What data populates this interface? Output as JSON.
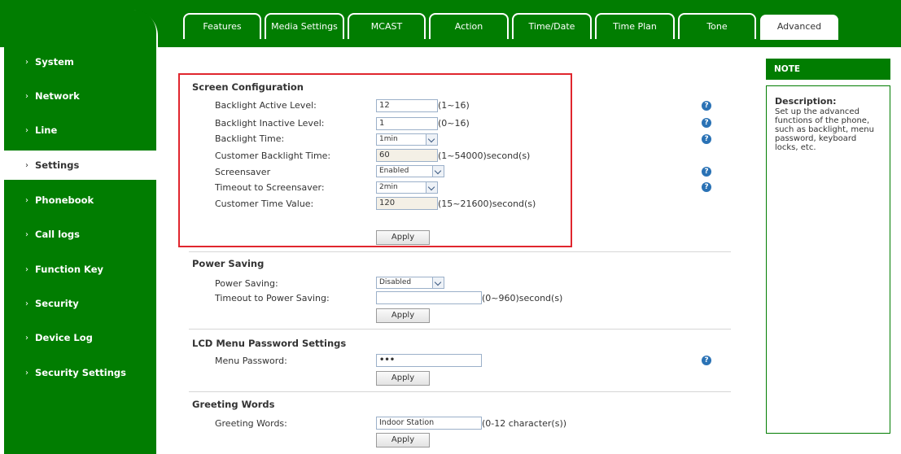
{
  "sidebar": {
    "items": [
      {
        "label": "System"
      },
      {
        "label": "Network"
      },
      {
        "label": "Line"
      },
      {
        "label": "Settings"
      },
      {
        "label": "Phonebook"
      },
      {
        "label": "Call logs"
      },
      {
        "label": "Function Key"
      },
      {
        "label": "Security"
      },
      {
        "label": "Device Log"
      },
      {
        "label": "Security Settings"
      }
    ],
    "chevron": "›"
  },
  "tabs": [
    {
      "label": "Features"
    },
    {
      "label": "Media Settings"
    },
    {
      "label": "MCAST"
    },
    {
      "label": "Action"
    },
    {
      "label": "Time/Date"
    },
    {
      "label": "Time Plan"
    },
    {
      "label": "Tone"
    },
    {
      "label": "Advanced"
    }
  ],
  "screen_config": {
    "title": "Screen Configuration",
    "backlight_active_label": "Backlight Active Level:",
    "backlight_active_value": "12",
    "backlight_active_hint": "(1~16)",
    "backlight_inactive_label": "Backlight Inactive Level:",
    "backlight_inactive_value": "1",
    "backlight_inactive_hint": "(0~16)",
    "backlight_time_label": "Backlight Time:",
    "backlight_time_value": "1min",
    "customer_backlight_label": "Customer Backlight Time:",
    "customer_backlight_value": "60",
    "customer_backlight_hint": "(1~54000)second(s)",
    "screensaver_label": "Screensaver",
    "screensaver_value": "Enabled",
    "timeout_screensaver_label": "Timeout to Screensaver:",
    "timeout_screensaver_value": "2min",
    "customer_time_label": "Customer Time Value:",
    "customer_time_value": "120",
    "customer_time_hint": "(15~21600)second(s)",
    "apply_label": "Apply"
  },
  "power_saving": {
    "title": "Power Saving",
    "power_saving_label": "Power Saving:",
    "power_saving_value": "Disabled",
    "timeout_label": "Timeout to Power Saving:",
    "timeout_value": "",
    "timeout_hint": "(0~960)second(s)",
    "apply_label": "Apply"
  },
  "lcd_password": {
    "title": "LCD Menu Password Settings",
    "menu_password_label": "Menu Password:",
    "menu_password_value": "•••",
    "apply_label": "Apply"
  },
  "greeting": {
    "title": "Greeting Words",
    "greeting_label": "Greeting Words:",
    "greeting_value": "Indoor Station",
    "greeting_hint": "(0-12 character(s))",
    "apply_label": "Apply"
  },
  "note": {
    "header": "NOTE",
    "title": "Description:",
    "text": "Set up the advanced functions of the phone, such as backlight, menu password, keyboard locks, etc."
  },
  "help_glyph": "?",
  "colors": {
    "brand_green": "#017d01",
    "highlight_red": "#e0262e",
    "help_blue": "#2a72b5"
  }
}
